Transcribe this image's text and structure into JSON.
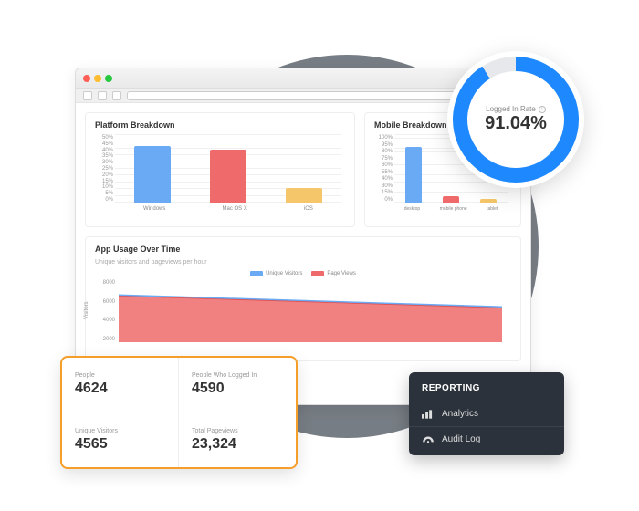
{
  "chart_data": [
    {
      "type": "bar",
      "title": "Platform Breakdown",
      "categories": [
        "Windows",
        "Mac OS X",
        "iOS"
      ],
      "values": [
        42,
        39,
        11
      ],
      "ylabel": "%",
      "ylim": [
        0,
        50
      ],
      "yticks": [
        0,
        5,
        10,
        15,
        20,
        25,
        30,
        35,
        40,
        45,
        50
      ],
      "colors": [
        "#6aa9f4",
        "#ef6a6a",
        "#f6c76a"
      ]
    },
    {
      "type": "bar",
      "title": "Mobile Breakdown",
      "categories": [
        "desktop",
        "mobile phone",
        "tablet"
      ],
      "values": [
        82,
        10,
        6
      ],
      "ylabel": "%",
      "ylim": [
        0,
        100
      ],
      "yticks": [
        0,
        15,
        30,
        40,
        55,
        60,
        75,
        80,
        95,
        100
      ],
      "colors": [
        "#6aa9f4",
        "#ef6a6a",
        "#f6c76a"
      ]
    },
    {
      "type": "area",
      "title": "App Usage Over Time",
      "subtitle": "Unique visitors and pageviews per hour",
      "xlabel": "",
      "ylabel": "Visitors",
      "ylim": [
        0,
        8000
      ],
      "yticks": [
        2000,
        4000,
        6000,
        8000
      ],
      "series": [
        {
          "name": "Unique Visitors",
          "color": "#6aa9f4",
          "values": [
            6000,
            5850,
            5700,
            5550,
            5400,
            5250,
            5100,
            4950,
            4800,
            4650,
            4500
          ]
        },
        {
          "name": "Page Views",
          "color": "#ef6a6a",
          "values": [
            5900,
            5750,
            5600,
            5450,
            5300,
            5150,
            5000,
            4850,
            4700,
            4550,
            4400
          ]
        }
      ]
    }
  ],
  "donut": {
    "label": "Logged In Rate",
    "value_pct": 91.04,
    "display": "91.04%"
  },
  "stats": [
    {
      "label": "People",
      "value": "4624"
    },
    {
      "label": "People Who Logged In",
      "value": "4590"
    },
    {
      "label": "Unique Visitors",
      "value": "4565"
    },
    {
      "label": "Total Pageviews",
      "value": "23,324"
    }
  ],
  "reporting": {
    "title": "REPORTING",
    "items": [
      {
        "label": "Analytics",
        "icon": "analytics-icon"
      },
      {
        "label": "Audit Log",
        "icon": "gauge-icon"
      }
    ]
  },
  "colors": {
    "blue": "#6aa9f4",
    "red": "#ef6a6a",
    "yellow": "#f6c76a",
    "accent": "#1e88ff",
    "orange_border": "#f59e2a",
    "panel_dark": "#2b323b"
  }
}
